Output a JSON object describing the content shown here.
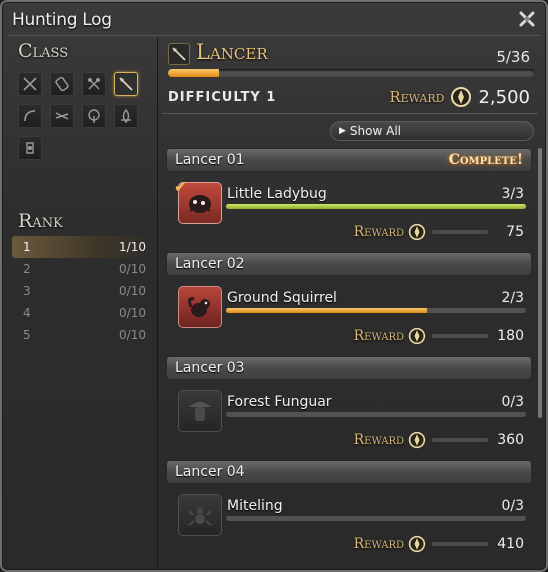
{
  "window": {
    "title": "Hunting Log"
  },
  "sidebar": {
    "class_heading": "Class",
    "classes": [
      {
        "name": "gladiator-sword-icon"
      },
      {
        "name": "pugilist-fist-icon"
      },
      {
        "name": "marauder-axe-icon"
      },
      {
        "name": "lancer-spear-icon",
        "active": true
      },
      {
        "name": "archer-bow-icon"
      },
      {
        "name": "rogue-daggers-icon"
      },
      {
        "name": "conjurer-tree-icon"
      },
      {
        "name": "thaumaturge-flame-icon"
      },
      {
        "name": "arcanist-book-icon"
      }
    ],
    "rank_heading": "Rank",
    "ranks": [
      {
        "rank": "1",
        "progress": "1/10",
        "active": true
      },
      {
        "rank": "2",
        "progress": "0/10"
      },
      {
        "rank": "3",
        "progress": "0/10"
      },
      {
        "rank": "4",
        "progress": "0/10"
      },
      {
        "rank": "5",
        "progress": "0/10"
      }
    ]
  },
  "header": {
    "job": "Lancer",
    "count": "5/36",
    "progress": 0.14,
    "difficulty": "DIFFICULTY 1",
    "reward_label": "Reward",
    "reward": "2,500"
  },
  "filter": {
    "label": "Show All"
  },
  "entries": [
    {
      "title": "Lancer 01",
      "status": "Complete!",
      "mob": "Little Ladybug",
      "count": "3/3",
      "progress": 1.0,
      "bar": "green",
      "reward_label": "Reward",
      "reward": "75",
      "state": "done"
    },
    {
      "title": "Lancer 02",
      "status": "",
      "mob": "Ground Squirrel",
      "count": "2/3",
      "progress": 0.67,
      "bar": "orange",
      "reward_label": "Reward",
      "reward": "180",
      "state": "progress"
    },
    {
      "title": "Lancer 03",
      "status": "",
      "mob": "Forest Funguar",
      "count": "0/3",
      "progress": 0,
      "bar": "orange",
      "reward_label": "Reward",
      "reward": "360",
      "state": "none"
    },
    {
      "title": "Lancer 04",
      "status": "",
      "mob": "Miteling",
      "count": "0/3",
      "progress": 0,
      "bar": "orange",
      "reward_label": "Reward",
      "reward": "410",
      "state": "none"
    }
  ],
  "colors": {
    "accent_gold": "#e8c07a",
    "bar_orange": "#e08a16",
    "bar_green": "#a6c53a"
  }
}
